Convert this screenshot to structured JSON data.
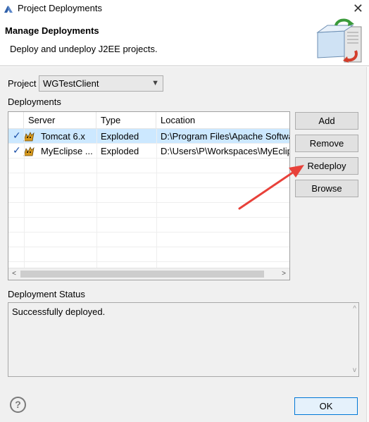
{
  "window": {
    "title": "Project Deployments",
    "close_glyph": "✕"
  },
  "banner": {
    "title": "Manage Deployments",
    "description": "Deploy and undeploy J2EE projects."
  },
  "project": {
    "label": "Project",
    "selected": "WGTestClient",
    "caret": "⌄"
  },
  "deployments": {
    "label": "Deployments",
    "columns": [
      "Server",
      "Type",
      "Location"
    ],
    "rows": [
      {
        "server": "Tomcat  6.x",
        "type": "Exploded",
        "location": "D:\\Program Files\\Apache Software",
        "checked": true,
        "selected": true
      },
      {
        "server": "MyEclipse ...",
        "type": "Exploded",
        "location": "D:\\Users\\P\\Workspaces\\MyEclipse",
        "checked": true,
        "selected": false
      }
    ],
    "check_glyph": "✓",
    "scroll_left": "<",
    "scroll_right": ">"
  },
  "buttons": {
    "add": "Add",
    "remove": "Remove",
    "redeploy": "Redeploy",
    "browse": "Browse",
    "ok": "OK"
  },
  "status": {
    "label": "Deployment Status",
    "text": "Successfully deployed.",
    "scroll_up": "^",
    "scroll_down": "v"
  },
  "help": {
    "glyph": "?"
  },
  "colors": {
    "selection": "#cce8ff",
    "focus_border": "#0078d7",
    "annotation_arrow": "#e8413a"
  }
}
